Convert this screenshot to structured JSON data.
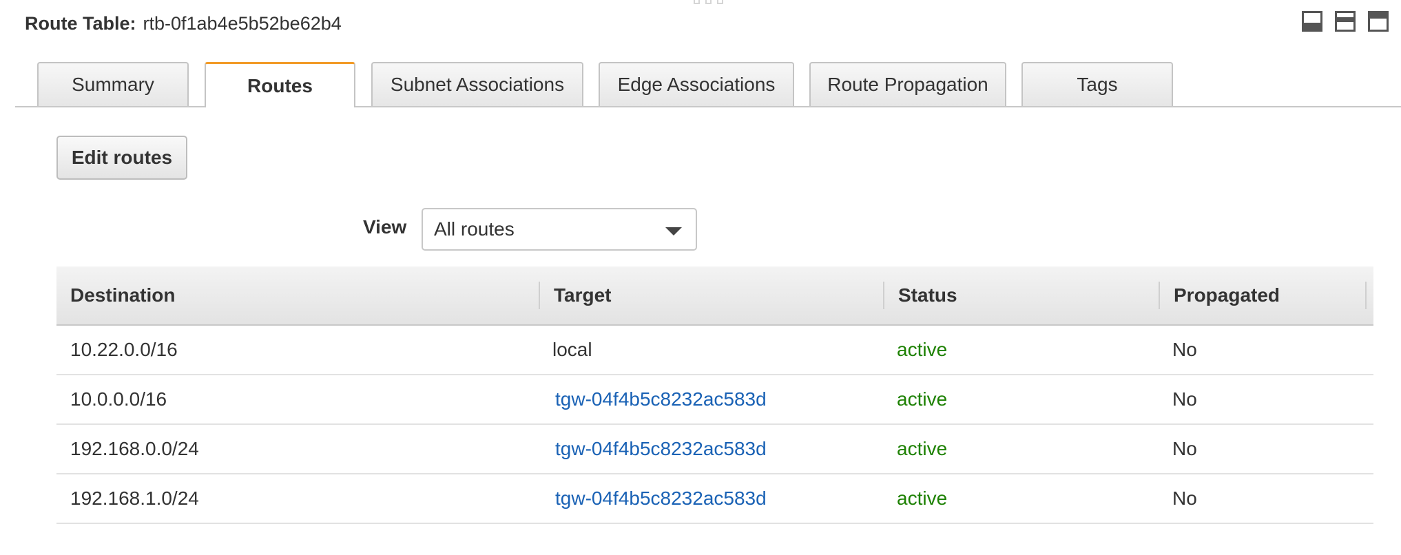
{
  "header": {
    "label": "Route Table:",
    "value": "rtb-0f1ab4e5b52be62b4"
  },
  "tabs": [
    {
      "label": "Summary",
      "active": false
    },
    {
      "label": "Routes",
      "active": true
    },
    {
      "label": "Subnet Associations",
      "active": false
    },
    {
      "label": "Edge Associations",
      "active": false
    },
    {
      "label": "Route Propagation",
      "active": false
    },
    {
      "label": "Tags",
      "active": false
    }
  ],
  "actions": {
    "edit_routes": "Edit routes"
  },
  "view": {
    "label": "View",
    "selected": "All routes"
  },
  "table": {
    "columns": [
      "Destination",
      "Target",
      "Status",
      "Propagated"
    ],
    "rows": [
      {
        "destination": "10.22.0.0/16",
        "target": "local",
        "target_link": false,
        "status": "active",
        "propagated": "No"
      },
      {
        "destination": "10.0.0.0/16",
        "target": "tgw-04f4b5c8232ac583d",
        "target_link": true,
        "status": "active",
        "propagated": "No"
      },
      {
        "destination": "192.168.0.0/24",
        "target": "tgw-04f4b5c8232ac583d",
        "target_link": true,
        "status": "active",
        "propagated": "No"
      },
      {
        "destination": "192.168.1.0/24",
        "target": "tgw-04f4b5c8232ac583d",
        "target_link": true,
        "status": "active",
        "propagated": "No"
      }
    ]
  },
  "colors": {
    "accent_tab": "#f29b28",
    "link": "#1a62b5",
    "status_active": "#1d8102"
  },
  "icons": {
    "layout_bottom": "panel-bottom-icon",
    "layout_middle": "panel-middle-icon",
    "layout_top": "panel-top-icon",
    "drag": "drag-handle-icon"
  }
}
